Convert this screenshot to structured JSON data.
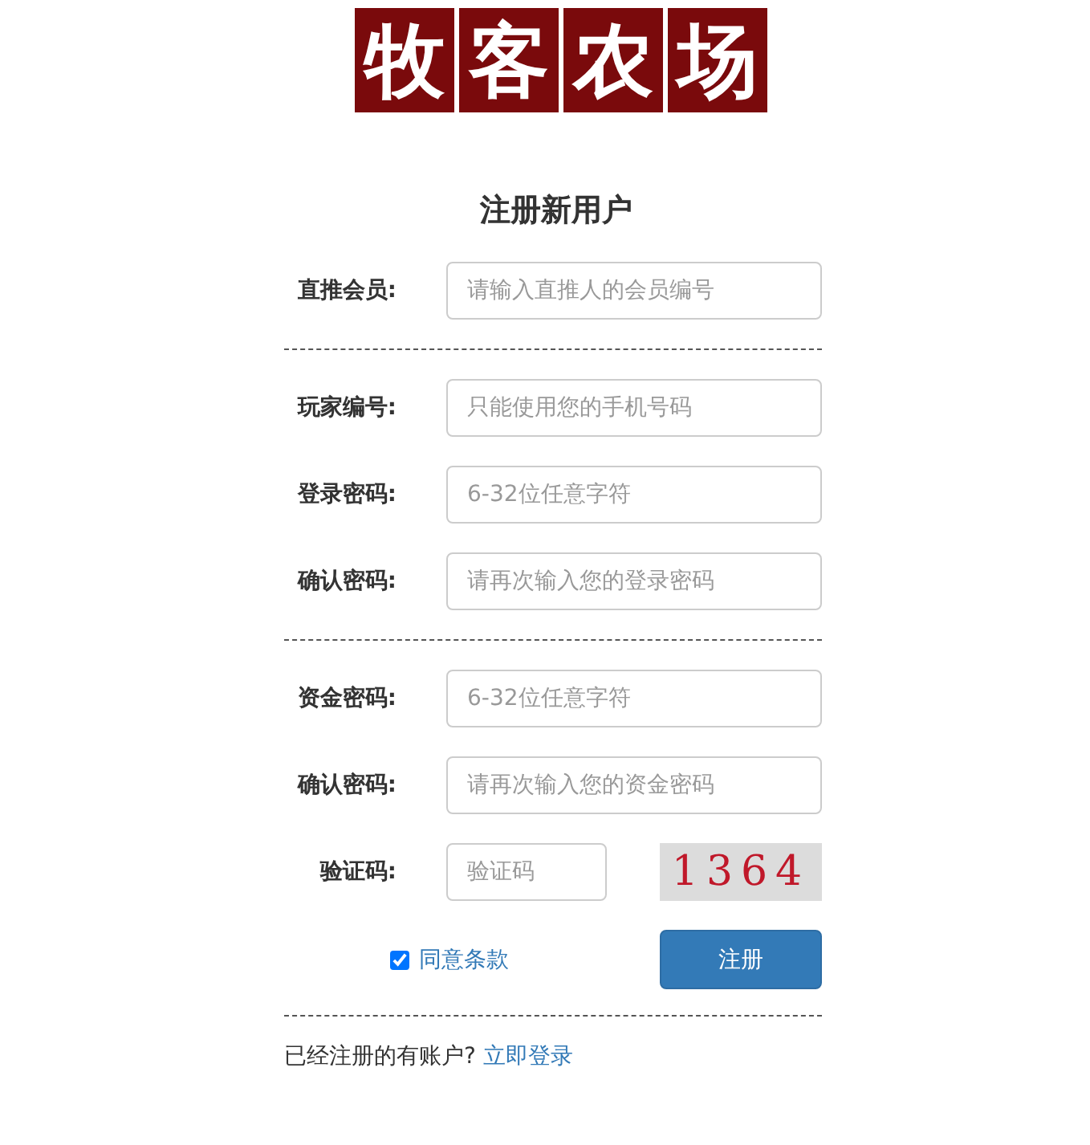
{
  "logo": {
    "characters": [
      "牧",
      "客",
      "农",
      "场"
    ]
  },
  "title": "注册新用户",
  "sections": [
    {
      "fields": [
        {
          "label": "直推会员:",
          "placeholder": "请输入直推人的会员编号"
        }
      ]
    },
    {
      "fields": [
        {
          "label": "玩家编号:",
          "placeholder": "只能使用您的手机号码"
        },
        {
          "label": "登录密码:",
          "placeholder": "6-32位任意字符"
        },
        {
          "label": "确认密码:",
          "placeholder": "请再次输入您的登录密码"
        }
      ]
    },
    {
      "fields": [
        {
          "label": "资金密码:",
          "placeholder": "6-32位任意字符"
        },
        {
          "label": "确认密码:",
          "placeholder": "请再次输入您的资金密码"
        }
      ]
    }
  ],
  "captcha": {
    "label": "验证码:",
    "placeholder": "验证码",
    "code": "1364"
  },
  "agree": {
    "label": "同意条款",
    "checked": true
  },
  "submit": "注册",
  "footer": {
    "text": "已经注册的有账户?",
    "link": "立即登录"
  }
}
